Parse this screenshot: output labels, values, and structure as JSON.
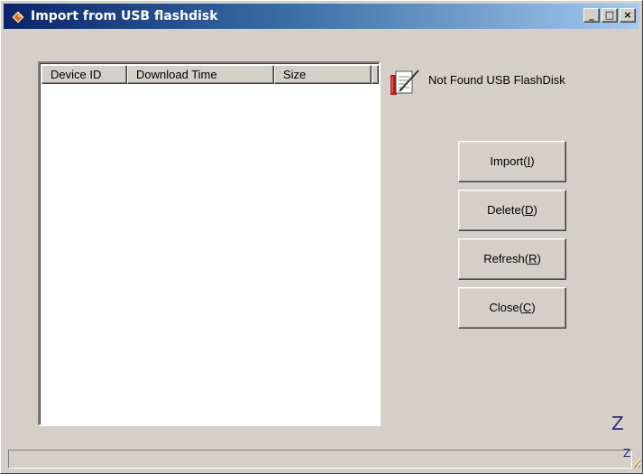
{
  "window": {
    "title": "Import from USB flashdisk",
    "controls": {
      "minimize": "_",
      "maximize": "□",
      "close": "×"
    }
  },
  "list": {
    "columns": [
      "Device ID",
      "Download Time",
      "Size",
      ""
    ],
    "rows": []
  },
  "status": {
    "icon": "usb-document-icon",
    "text": "Not Found USB FlashDisk"
  },
  "buttons": {
    "import": {
      "label": "Import(",
      "hotkey": "I",
      "suffix": ")"
    },
    "delete": {
      "label": "Delete(",
      "hotkey": "D",
      "suffix": ")"
    },
    "refresh": {
      "label": "Refresh(",
      "hotkey": "R",
      "suffix": ")"
    },
    "close": {
      "label": "Close(",
      "hotkey": "C",
      "suffix": ")"
    }
  },
  "footer": {
    "mark": "Z",
    "grip_mark": "Z"
  },
  "colors": {
    "title_start": "#0a246a",
    "title_end": "#a6caf0",
    "face": "#d4d0c8"
  }
}
